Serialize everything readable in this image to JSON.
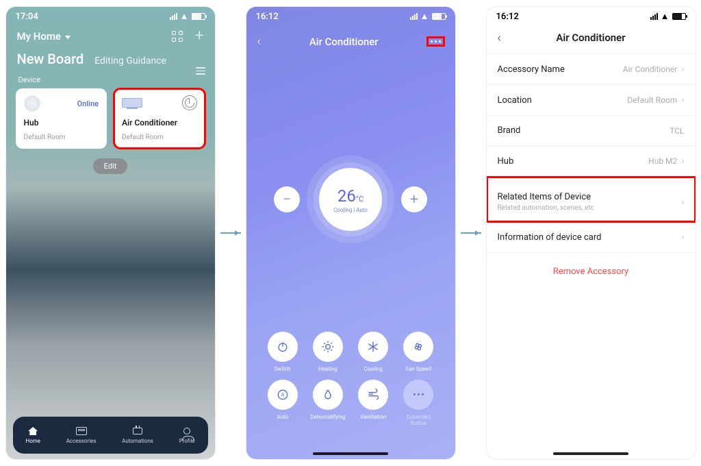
{
  "s1": {
    "time": "17:04",
    "home": "My Home",
    "new_board": "New Board",
    "editing": "Editing Guidance",
    "device_lbl": "Device",
    "card1": {
      "title": "Hub",
      "room": "Default Room",
      "status": "Online"
    },
    "card2": {
      "title": "Air Conditioner",
      "room": "Default Room"
    },
    "edit": "Edit",
    "tabs": {
      "home": "Home",
      "acc": "Accessories",
      "auto": "Automations",
      "prof": "Profile"
    }
  },
  "s2": {
    "time": "16:12",
    "title": "Air Conditioner",
    "temp": "26",
    "unit": "°C",
    "mode": "Cooling | Auto",
    "ctrls": [
      "Switch",
      "Heating",
      "Cooling",
      "Fan Speed",
      "Auto",
      "Dehumidifying",
      "Ventilation",
      "Expanded Button"
    ]
  },
  "s3": {
    "time": "16:12",
    "title": "Air Conditioner",
    "rows": {
      "name_l": "Accessory Name",
      "name_v": "Air Conditioner",
      "loc_l": "Location",
      "loc_v": "Default Room",
      "brand_l": "Brand",
      "brand_v": "TCL",
      "hub_l": "Hub",
      "hub_v": "Hub M2",
      "rel_l": "Related Items of Device",
      "rel_s": "Related automation, scenes, etc",
      "info_l": "Information of device card"
    },
    "remove": "Remove Accessory"
  }
}
